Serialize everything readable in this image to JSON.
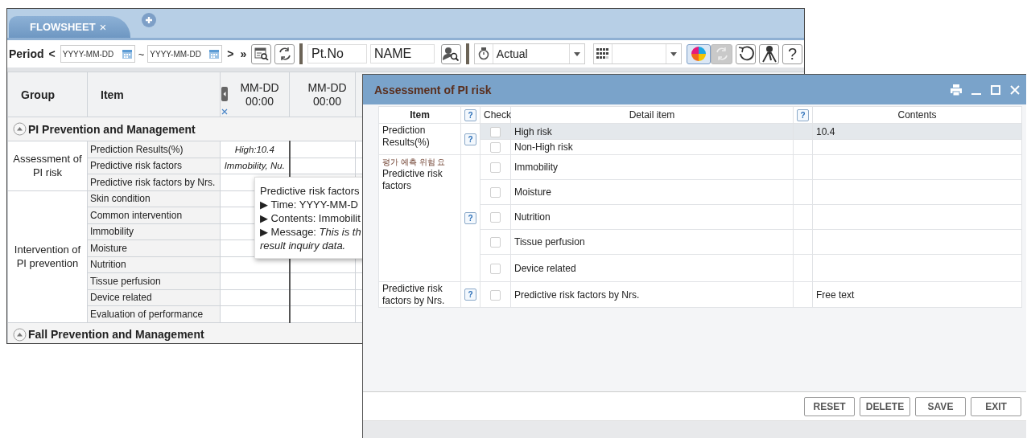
{
  "flowsheet": {
    "tabs": [
      {
        "label": "FLOWSHEET",
        "close": "×",
        "selected": true
      }
    ],
    "toolbar": {
      "period_label": "Period",
      "prev": "<",
      "start_placeholder": "YYYY-MM-DD",
      "separator": "~",
      "end_placeholder": "YYYY-MM-DD",
      "next": ">",
      "last": "»",
      "patient_no_placeholder": "Pt.No",
      "name_placeholder": "NAME",
      "mode": "Actual",
      "color_mode_on": true,
      "sync_disabled": true,
      "help": "?"
    },
    "table": {
      "columns": [
        "Group",
        "Item"
      ],
      "time_columns": [
        {
          "date": "MM-DD",
          "time": "00:00"
        },
        {
          "date": "MM-DD",
          "time": "00:00"
        }
      ],
      "sections": [
        {
          "title": "PI Prevention and Management",
          "expanded": true,
          "groups": [
            {
              "name": "Assessment of PI risk",
              "rows": [
                {
                  "item": "Prediction Results(%)",
                  "value": "High:10.4"
                },
                {
                  "item": "Predictive risk factors",
                  "value": "Immobility, Nu."
                },
                {
                  "item": "Predictive risk factors by Nrs."
                }
              ]
            },
            {
              "name": "Intervention of PI prevention",
              "rows": [
                {
                  "item": "Skin condition"
                },
                {
                  "item": "Common intervention"
                },
                {
                  "item": "Immobility"
                },
                {
                  "item": "Moisture"
                },
                {
                  "item": "Nutrition"
                },
                {
                  "item": "Tissue perfusion"
                },
                {
                  "item": "Device related"
                },
                {
                  "item": "Evaluation of performance"
                }
              ]
            }
          ]
        },
        {
          "title": "Fall Prevention and Management",
          "expanded": true
        }
      ]
    }
  },
  "tooltip": {
    "title": "Predictive risk factors",
    "lines": [
      {
        "text": "▶ Time: YYYY-MM-D",
        "italic": false
      },
      {
        "text": "▶ Contents: Immobilit",
        "italic": false
      },
      {
        "text": "▶ Message:  *This is th*",
        "italic": false
      },
      {
        "text": "result inquiry data.",
        "italic": true
      }
    ]
  },
  "dialog": {
    "title": "Assessment of PI risk",
    "columns": [
      {
        "label": "Item",
        "kind": "text"
      },
      {
        "label": "?",
        "kind": "help"
      },
      {
        "label": "Check",
        "kind": "text"
      },
      {
        "label": "Detail item",
        "kind": "text"
      },
      {
        "label": "?",
        "kind": "help"
      },
      {
        "label": "Contents",
        "kind": "text"
      }
    ],
    "rows": [
      {
        "item": "Prediction Results(%)",
        "help": "?",
        "details": [
          {
            "label": "High risk",
            "contents": "10.4",
            "checked": false,
            "selected": true
          },
          {
            "label": "Non-High risk",
            "checked": false,
            "selected": false
          }
        ]
      },
      {
        "note": "평가 예측 위험 요",
        "item": "Predictive risk factors",
        "help": "?",
        "details": [
          {
            "label": "Immobility",
            "checked": false,
            "selected": false
          },
          {
            "label": "Moisture",
            "checked": false,
            "selected": false
          },
          {
            "label": "Nutrition",
            "checked": false,
            "selected": false
          },
          {
            "label": "Tissue perfusion",
            "checked": false,
            "selected": false
          },
          {
            "label": "Device related",
            "checked": false,
            "selected": false
          }
        ]
      },
      {
        "item": "Predictive risk factors by Nrs.",
        "help": "?",
        "details": [
          {
            "label": "Predictive risk factors by Nrs.",
            "contents": "Free text",
            "checked": false,
            "selected": false
          }
        ]
      }
    ],
    "buttons": [
      "RESET",
      "DELETE",
      "SAVE",
      "EXIT"
    ]
  }
}
